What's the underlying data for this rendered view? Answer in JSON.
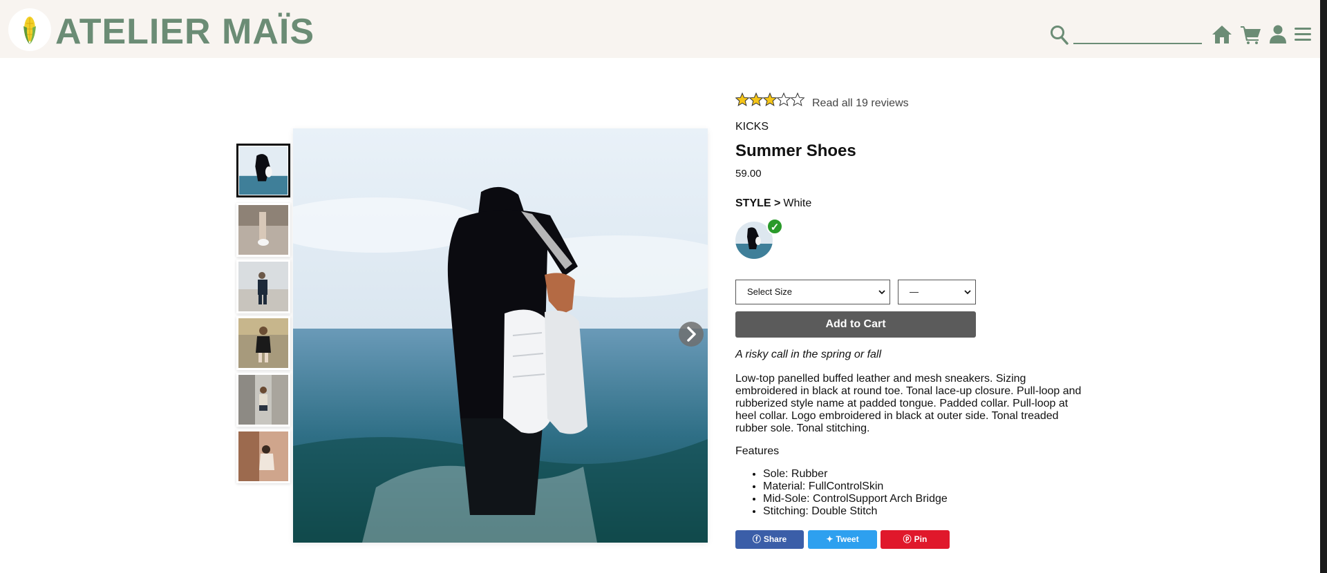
{
  "header": {
    "brand": "ATELIER MAÏS",
    "logo_icon": "corn-icon",
    "search_placeholder": "",
    "icons": [
      "search-icon",
      "home-icon",
      "cart-icon",
      "user-icon",
      "menu-icon"
    ],
    "accent_color": "#6b8c75"
  },
  "gallery": {
    "thumbnails": [
      "thumb-1",
      "thumb-2",
      "thumb-3",
      "thumb-4",
      "thumb-5",
      "thumb-6"
    ],
    "active_index": 0,
    "next_icon": "chevron-right-icon"
  },
  "product": {
    "rating": 3,
    "rating_max": 5,
    "reviews_text": "Read all 19 reviews",
    "brand": "KICKS",
    "title": "Summer Shoes",
    "price": "59.00",
    "style_label": "STYLE >",
    "style_value": "White",
    "size_select": "Select Size",
    "qty_select": "—",
    "add_to_cart": "Add to Cart",
    "tagline": "A risky call in the spring or fall",
    "description": "Low-top panelled buffed leather and mesh sneakers. Sizing embroidered in black at round toe. Tonal lace-up closure. Pull-loop and rubberized style name at padded tongue. Padded collar. Pull-loop at heel collar. Logo embroidered in black at outer side. Tonal treaded rubber sole. Tonal stitching.",
    "features_title": "Features",
    "features": [
      "Sole: Rubber",
      "Material: FullControlSkin",
      "Mid-Sole: ControlSupport Arch Bridge",
      "Stitching: Double Stitch"
    ]
  },
  "share": {
    "facebook": "Share",
    "twitter": "Tweet",
    "pinterest": "Pin",
    "facebook_color": "#3b5ea8",
    "twitter_color": "#2ea0ef",
    "pinterest_color": "#e0182b"
  }
}
